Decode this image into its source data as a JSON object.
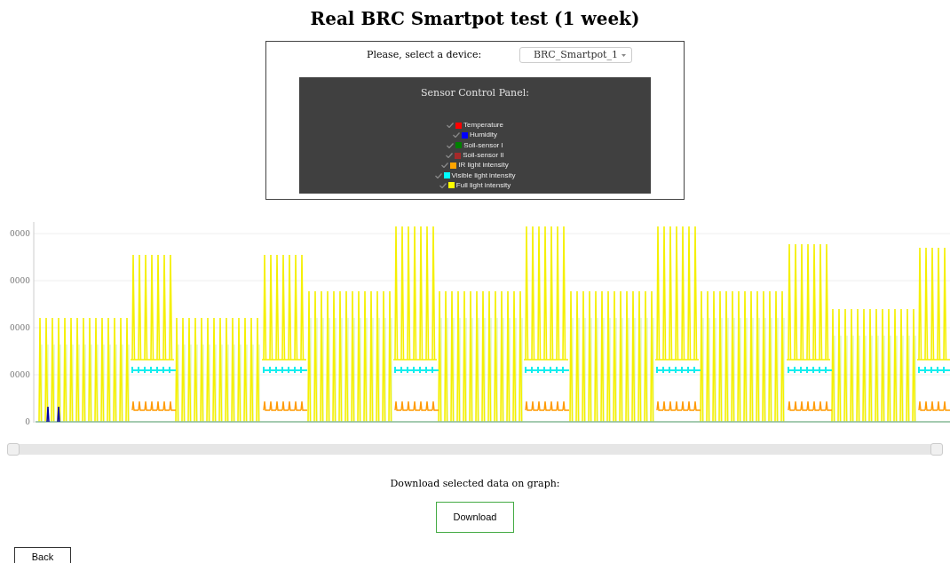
{
  "title": "Real BRC Smartpot test (1 week)",
  "device": {
    "label": "Please, select a device:",
    "value": "BRC_Smartpot_1"
  },
  "panel": {
    "title": "Sensor Control Panel:",
    "sensors": [
      {
        "name": "Temperature",
        "checked": true,
        "color": "#ff0000"
      },
      {
        "name": "Humidity",
        "checked": true,
        "color": "#0000ff"
      },
      {
        "name": "Soil-sensor I",
        "checked": true,
        "color": "#008000"
      },
      {
        "name": "Soil-sensor II",
        "checked": true,
        "color": "#a52a2a"
      },
      {
        "name": "IR light intensity",
        "checked": true,
        "color": "#ffa500"
      },
      {
        "name": "Visible light intensity",
        "checked": true,
        "color": "#00ffff"
      },
      {
        "name": "Full light intensity",
        "checked": true,
        "color": "#ffff00"
      }
    ]
  },
  "chart": {
    "y_labels": [
      "0000",
      "0000",
      "0000",
      "0000",
      "0"
    ]
  },
  "slider": {
    "handles": [
      {
        "level": 0
      },
      {
        "level": 1
      }
    ]
  },
  "download": {
    "caption": "Download selected data on graph:",
    "button": "Download"
  },
  "back": "Back"
}
